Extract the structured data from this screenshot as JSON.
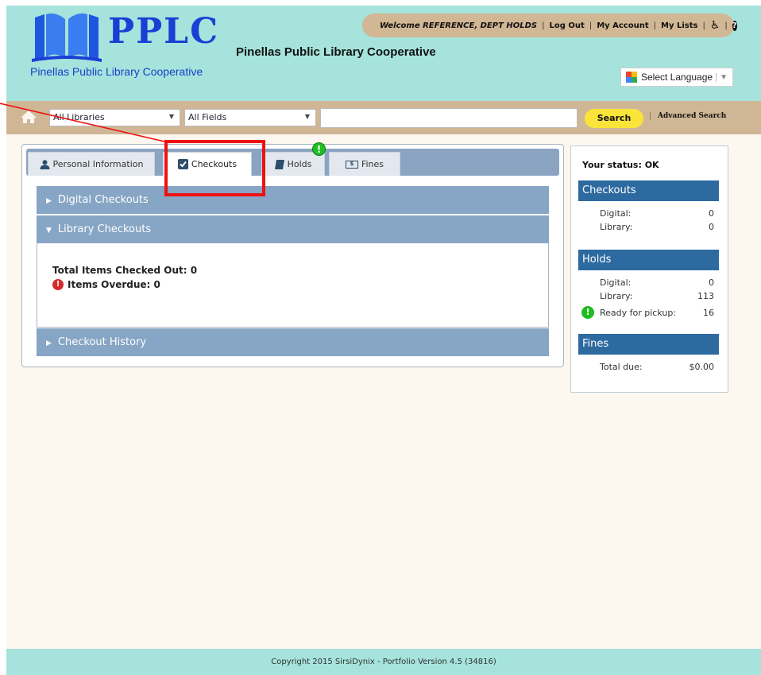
{
  "brand": {
    "logo_text": "PPLC",
    "logo_subtitle": "Pinellas Public Library Cooperative",
    "site_title": "Pinellas Public Library Cooperative"
  },
  "userbar": {
    "welcome": "Welcome REFERENCE, DEPT HOLDS",
    "logout": "Log Out",
    "my_account": "My Account",
    "my_lists": "My Lists",
    "icons": [
      "accessibility-icon",
      "help-icon"
    ]
  },
  "language": {
    "label": "Select Language",
    "caret": "▼"
  },
  "search": {
    "library_select": "All Libraries",
    "field_select": "All Fields",
    "query": "",
    "button": "Search",
    "advanced": "Advanced Search"
  },
  "tabs": [
    {
      "label": "Personal Information",
      "icon": "user-icon",
      "active": false
    },
    {
      "label": "Checkouts",
      "icon": "checkbox-icon",
      "active": true
    },
    {
      "label": "Holds",
      "icon": "book-icon",
      "active": false,
      "badge": "!"
    },
    {
      "label": "Fines",
      "icon": "money-icon",
      "active": false
    }
  ],
  "accordion": {
    "digital": "Digital Checkouts",
    "library": "Library Checkouts",
    "history": "Checkout History",
    "total_items": "Total Items Checked Out: 0",
    "items_overdue": "Items Overdue: 0"
  },
  "status": {
    "title": "Your status: OK",
    "checkouts_head": "Checkouts",
    "checkouts": [
      {
        "label": "Digital:",
        "value": "0"
      },
      {
        "label": "Library:",
        "value": "0"
      }
    ],
    "holds_head": "Holds",
    "holds": [
      {
        "label": "Digital:",
        "value": "0"
      },
      {
        "label": "Library:",
        "value": "113"
      },
      {
        "label": "Ready for pickup:",
        "value": "16"
      }
    ],
    "fines_head": "Fines",
    "fines": [
      {
        "label": "Total due:",
        "value": "$0.00"
      }
    ]
  },
  "footer": {
    "text": "Copyright 2015 SirsiDynix - Portfolio Version 4.5 (34816)"
  },
  "colors": {
    "header_bg": "#a5e3dc",
    "search_bar_bg": "#cfb796",
    "search_button": "#fbe43a",
    "accordion_header": "#87a5c5",
    "status_section": "#2d6aa0",
    "annotation": "#ee1111"
  }
}
